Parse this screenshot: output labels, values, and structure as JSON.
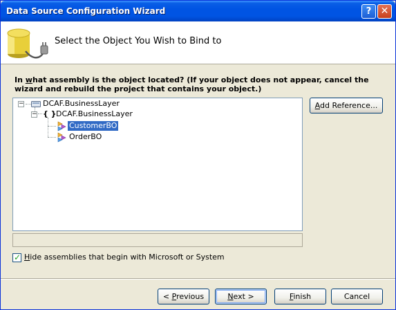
{
  "window": {
    "title": "Data Source Configuration Wizard",
    "help_label": "?",
    "close_label": "✕"
  },
  "header": {
    "title": "Select the Object You Wish to Bind to"
  },
  "prompt": {
    "text_before_underline": "In ",
    "underlined": "w",
    "text_after_underline": "hat assembly is the object located? (If your object does not appear, cancel the wizard and rebuild the project that contains your object.)"
  },
  "tree": {
    "nodes": [
      {
        "label": "DCAF.BusinessLayer",
        "expander": "−",
        "icon": "assembly-icon"
      },
      {
        "label": "DCAF.BusinessLayer",
        "expander": "−",
        "icon": "namespace-icon",
        "icon_text": "{ }"
      },
      {
        "label": "CustomerBO",
        "icon": "class-icon",
        "selected": true
      },
      {
        "label": "OrderBO",
        "icon": "class-icon"
      }
    ]
  },
  "add_reference": {
    "label_underlined": "A",
    "label_rest": "dd Reference..."
  },
  "hide_assemblies": {
    "checked": true,
    "label_underlined": "H",
    "label_rest": "ide assemblies that begin with Microsoft or System"
  },
  "buttons": {
    "previous": {
      "prefix": "< ",
      "underlined": "P",
      "rest": "revious"
    },
    "next": {
      "prefix": "",
      "underlined": "N",
      "rest": "ext >"
    },
    "finish": {
      "prefix": "",
      "underlined": "F",
      "rest": "inish"
    },
    "cancel": {
      "label": "Cancel"
    }
  },
  "colors": {
    "titlebar": "#0054e3",
    "selection": "#316ac5",
    "dialog_bg": "#ece9d8"
  }
}
